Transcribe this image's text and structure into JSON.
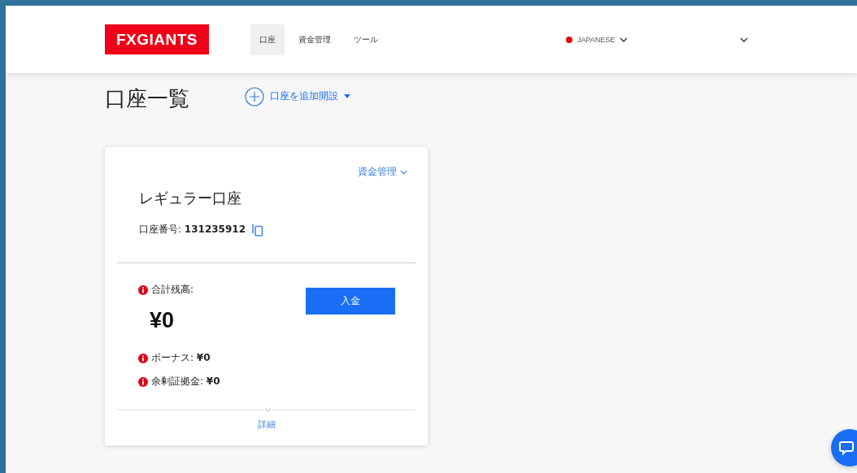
{
  "header": {
    "logo": "FXGIANTS",
    "nav": [
      {
        "label": "口座",
        "selected": true
      },
      {
        "label": "資金管理",
        "selected": false
      },
      {
        "label": "ツール",
        "selected": false
      }
    ],
    "language": {
      "label": "JAPANESE",
      "color": "#e00000"
    }
  },
  "page": {
    "title": "口座一覧",
    "add_account": "口座を追加開設"
  },
  "account_card": {
    "funds_menu": "資金管理",
    "name": "レギュラー口座",
    "number": "口座番号: **131235912**",
    "total_label": "合計残高:",
    "total_value": "¥0",
    "deposit_button": "入金",
    "details": [
      "ボーナス: **¥0**",
      "余剰証拠金: **¥0**"
    ],
    "more": "詳細"
  }
}
